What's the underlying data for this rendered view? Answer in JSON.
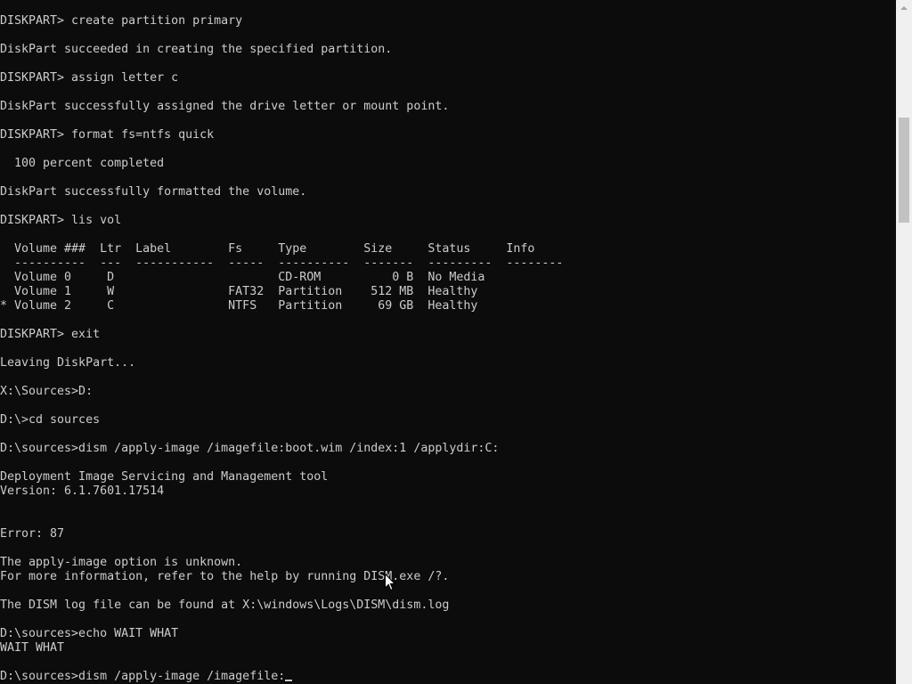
{
  "window": {
    "type": "command-prompt-console"
  },
  "terminal": {
    "lines": [
      "DISKPART> create partition primary",
      "",
      "DiskPart succeeded in creating the specified partition.",
      "",
      "DISKPART> assign letter c",
      "",
      "DiskPart successfully assigned the drive letter or mount point.",
      "",
      "DISKPART> format fs=ntfs quick",
      "",
      "  100 percent completed",
      "",
      "DiskPart successfully formatted the volume.",
      "",
      "DISKPART> lis vol",
      "",
      "  Volume ###  Ltr  Label        Fs     Type        Size     Status     Info",
      "  ----------  ---  -----------  -----  ----------  -------  ---------  --------",
      "  Volume 0     D                       CD-ROM          0 B  No Media",
      "  Volume 1     W                FAT32  Partition    512 MB  Healthy",
      "* Volume 2     C                NTFS   Partition     69 GB  Healthy",
      "",
      "DISKPART> exit",
      "",
      "Leaving DiskPart...",
      "",
      "X:\\Sources>D:",
      "",
      "D:\\>cd sources",
      "",
      "D:\\sources>dism /apply-image /imagefile:boot.wim /index:1 /applydir:C:",
      "",
      "Deployment Image Servicing and Management tool",
      "Version: 6.1.7601.17514",
      "",
      "",
      "Error: 87",
      "",
      "The apply-image option is unknown.",
      "For more information, refer to the help by running DISM.exe /?.",
      "",
      "The DISM log file can be found at X:\\windows\\Logs\\DISM\\dism.log",
      "",
      "D:\\sources>echo WAIT WHAT",
      "WAIT WHAT",
      "",
      "D:\\sources>dism /apply-image /imagefile:"
    ],
    "cursor_visible": true
  },
  "scrollbar": {
    "position_fraction": 0.18
  },
  "colors": {
    "background": "#0c0c0c",
    "foreground": "#cccccc",
    "scrollbar_track": "#f0f0f0",
    "scrollbar_thumb": "#c2c2c2"
  },
  "icons": {
    "pointer": "mouse-pointer-icon",
    "scroll_up": "scroll-up-arrow-icon"
  }
}
